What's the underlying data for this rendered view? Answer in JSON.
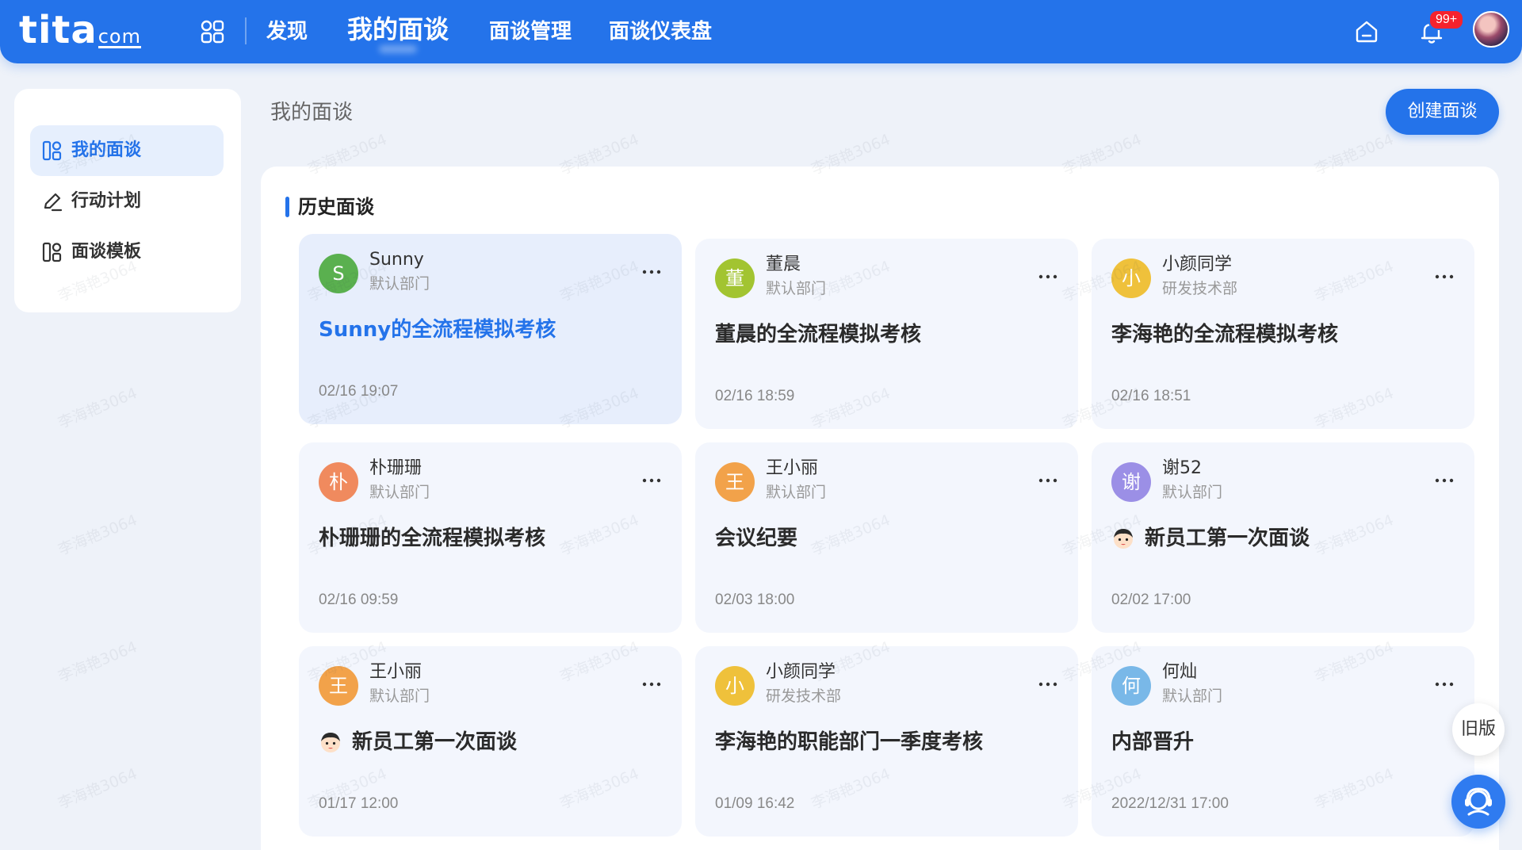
{
  "header": {
    "logo_main": "tita",
    "logo_suffix": "com",
    "nav": [
      "发现",
      "我的面谈",
      "面谈管理",
      "面谈仪表盘"
    ],
    "active_nav": "我的面谈",
    "notification_count": "99+"
  },
  "sidebar": {
    "items": [
      {
        "label": "我的面谈",
        "icon": "grid-icon",
        "active": true
      },
      {
        "label": "行动计划",
        "icon": "pencil-icon",
        "active": false
      },
      {
        "label": "面谈模板",
        "icon": "grid-icon",
        "active": false
      }
    ]
  },
  "main": {
    "page_title": "我的面谈",
    "create_button": "创建面谈",
    "section_title": "历史面谈"
  },
  "cards": [
    {
      "initial": "S",
      "name": "Sunny",
      "dept": "默认部门",
      "title": "Sunny的全流程模拟考核",
      "time": "02/16 19:07",
      "color": "#5ab04f",
      "emoji": false,
      "selected": true
    },
    {
      "initial": "董",
      "name": "董晨",
      "dept": "默认部门",
      "title": "董晨的全流程模拟考核",
      "time": "02/16 18:59",
      "color": "#a2c431",
      "emoji": false,
      "selected": false
    },
    {
      "initial": "小",
      "name": "小颜同学",
      "dept": "研发技术部",
      "title": "李海艳的全流程模拟考核",
      "time": "02/16 18:51",
      "color": "#efc13b",
      "emoji": false,
      "selected": false
    },
    {
      "initial": "朴",
      "name": "朴珊珊",
      "dept": "默认部门",
      "title": "朴珊珊的全流程模拟考核",
      "time": "02/16 09:59",
      "color": "#f08a5e",
      "emoji": false,
      "selected": false
    },
    {
      "initial": "王",
      "name": "王小丽",
      "dept": "默认部门",
      "title": "会议纪要",
      "time": "02/03 18:00",
      "color": "#f2a24a",
      "emoji": false,
      "selected": false
    },
    {
      "initial": "谢",
      "name": "谢52",
      "dept": "默认部门",
      "title": "新员工第一次面谈",
      "time": "02/02 17:00",
      "color": "#9b8fe6",
      "emoji": true,
      "selected": false
    },
    {
      "initial": "王",
      "name": "王小丽",
      "dept": "默认部门",
      "title": "新员工第一次面谈",
      "time": "01/17 12:00",
      "color": "#f2a24a",
      "emoji": true,
      "selected": false
    },
    {
      "initial": "小",
      "name": "小颜同学",
      "dept": "研发技术部",
      "title": "李海艳的职能部门一季度考核",
      "time": "01/09 16:42",
      "color": "#efc13b",
      "emoji": false,
      "selected": false
    },
    {
      "initial": "何",
      "name": "何灿",
      "dept": "默认部门",
      "title": "内部晋升",
      "time": "2022/12/31 17:00",
      "color": "#79b8e8",
      "emoji": false,
      "selected": false
    }
  ],
  "floating": {
    "old_version": "旧版",
    "service_icon": "customer-service-icon"
  },
  "watermark": "李海艳3064",
  "colors": {
    "brand": "#2473ea",
    "card_bg": "#f3f6fd",
    "selected_card_bg": "#e7eefc"
  }
}
